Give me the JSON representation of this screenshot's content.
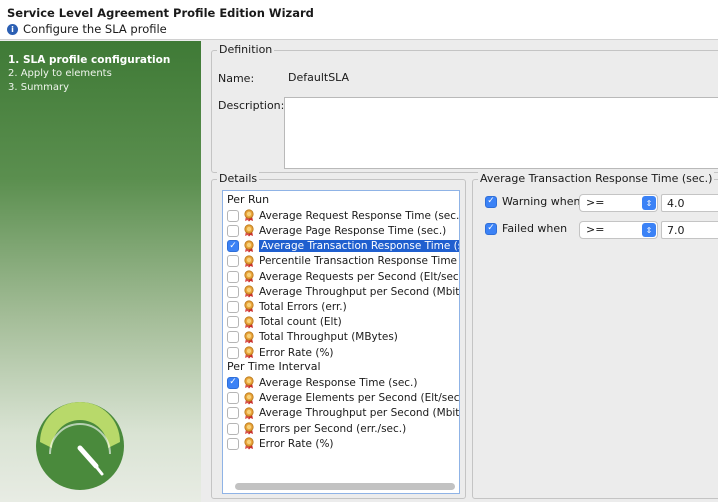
{
  "wizard": {
    "title": "Service Level Agreement Profile Edition Wizard",
    "subtitle": "Configure the SLA profile",
    "subtitle_icon": "info-icon"
  },
  "steps": [
    {
      "label": "1. SLA profile configuration",
      "active": true
    },
    {
      "label": "2. Apply to elements",
      "active": false
    },
    {
      "label": "3. Summary",
      "active": false
    }
  ],
  "definition": {
    "group_label": "Definition",
    "name_label": "Name:",
    "name_value": "DefaultSLA",
    "description_label": "Description:",
    "description_value": ""
  },
  "details": {
    "group_label": "Details",
    "per_run_header": "Per Run",
    "per_run_items": [
      {
        "label": "Average Request Response Time (sec.)",
        "checked": false,
        "selected": false
      },
      {
        "label": "Average Page Response Time (sec.)",
        "checked": false,
        "selected": false
      },
      {
        "label": "Average Transaction Response Time (sec.",
        "checked": true,
        "selected": true
      },
      {
        "label": "Percentile Transaction Response Time (se",
        "checked": false,
        "selected": false
      },
      {
        "label": "Average Requests per Second (Elt/sec.)",
        "checked": false,
        "selected": false
      },
      {
        "label": "Average Throughput per Second (Mbit/se",
        "checked": false,
        "selected": false
      },
      {
        "label": "Total Errors (err.)",
        "checked": false,
        "selected": false
      },
      {
        "label": "Total count (Elt)",
        "checked": false,
        "selected": false
      },
      {
        "label": "Total Throughput (MBytes)",
        "checked": false,
        "selected": false
      },
      {
        "label": "Error Rate (%)",
        "checked": false,
        "selected": false
      }
    ],
    "per_interval_header": "Per Time Interval",
    "per_interval_items": [
      {
        "label": "Average Response Time (sec.)",
        "checked": true,
        "selected": false
      },
      {
        "label": "Average Elements per Second (Elt/sec.)",
        "checked": false,
        "selected": false
      },
      {
        "label": "Average Throughput per Second (Mbit/se",
        "checked": false,
        "selected": false
      },
      {
        "label": "Errors per Second (err./sec.)",
        "checked": false,
        "selected": false
      },
      {
        "label": "Error Rate (%)",
        "checked": false,
        "selected": false
      }
    ]
  },
  "threshold": {
    "group_label": "Average Transaction Response Time (sec.)",
    "warning": {
      "label": "Warning when",
      "checked": true,
      "operator": ">=",
      "value": "4.0"
    },
    "failed": {
      "label": "Failed when",
      "checked": true,
      "operator": ">=",
      "value": "7.0"
    }
  },
  "colors": {
    "accent": "#3b82f6",
    "selection": "#1f5fcf",
    "sidebar_top": "#3f7a36"
  }
}
